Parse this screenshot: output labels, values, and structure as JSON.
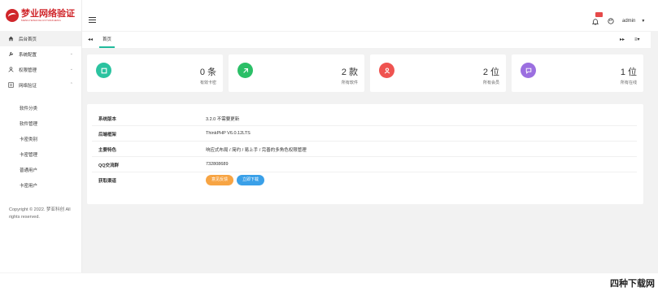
{
  "logo": {
    "title": "梦业网络验证",
    "subtitle": "MENGYEWANGLUOYANZHENG"
  },
  "sidebar": {
    "items": [
      {
        "label": "后台首页",
        "icon": "home-icon",
        "expandable": false
      },
      {
        "label": "系统配置",
        "icon": "wrench-icon",
        "expandable": true
      },
      {
        "label": "权限管理",
        "icon": "people-icon",
        "expandable": true
      },
      {
        "label": "网络验证",
        "icon": "list-icon",
        "expandable": true
      }
    ],
    "submenu": [
      "软件分类",
      "软件管理",
      "卡密类别",
      "卡密管理",
      "普通用户",
      "卡密用户"
    ],
    "copyright": "Copyright © 2022. 梦亚科创 All rights reserved."
  },
  "header": {
    "bell_badge": "",
    "user": "admin"
  },
  "tabs": {
    "active": "首页"
  },
  "stats": [
    {
      "value": "0 条",
      "label": "有效卡密",
      "color": "#2bc3a0",
      "icon": "card-icon"
    },
    {
      "value": "2 款",
      "label": "所有软件",
      "color": "#2bbf67",
      "icon": "app-icon"
    },
    {
      "value": "2 位",
      "label": "所有会员",
      "color": "#ef5350",
      "icon": "user-icon"
    },
    {
      "value": "1 位",
      "label": "所有在线",
      "color": "#9b6fe0",
      "icon": "chat-icon"
    }
  ],
  "info": [
    {
      "key": "系统版本",
      "value": "3.2.0 不需要更新"
    },
    {
      "key": "后端框架",
      "value": "ThinkPHP V6.0.12LTS"
    },
    {
      "key": "主要特色",
      "value": "响应式布局 / 简约 / 易上手 / 完善的多角色权限管理"
    },
    {
      "key": "QQ交流群",
      "value": "732808689"
    },
    {
      "key": "获取渠道",
      "value": ""
    }
  ],
  "buttons": {
    "feedback": "意见反馈",
    "download": "立即下载"
  },
  "watermark": "四种下载网"
}
